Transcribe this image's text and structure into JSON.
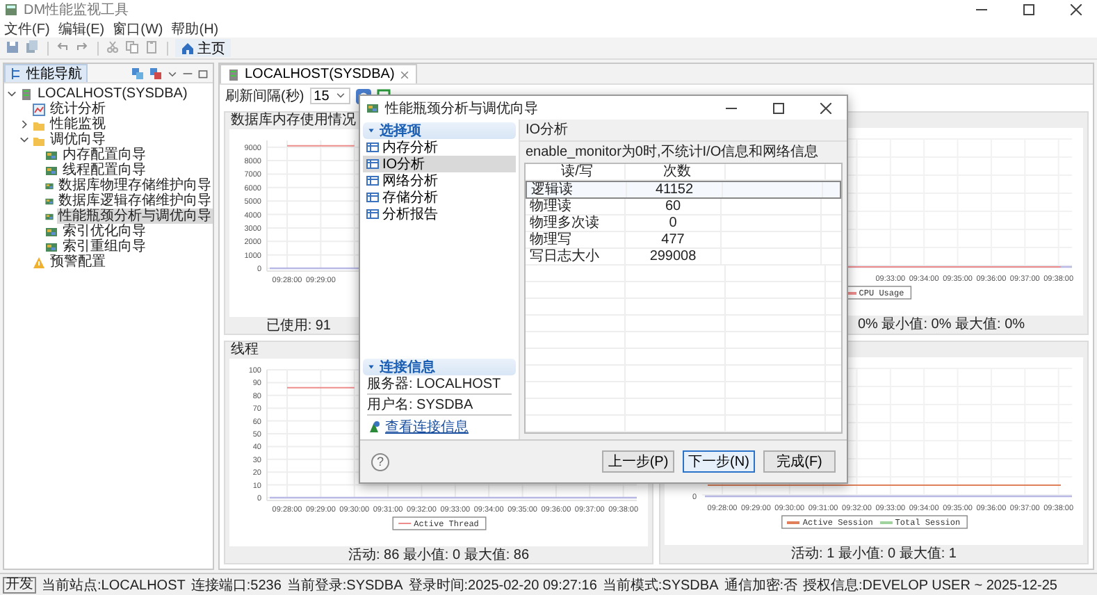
{
  "window": {
    "title": "DM性能监视工具"
  },
  "menu": [
    "文件(F)",
    "编辑(E)",
    "窗口(W)",
    "帮助(H)"
  ],
  "toolbar": {
    "home_tab": "主页"
  },
  "navigator": {
    "title": "性能导航",
    "tree": [
      {
        "label": "LOCALHOST(SYSDBA)",
        "kind": "server",
        "expanded": true,
        "selected": false,
        "children": [
          {
            "label": "统计分析",
            "kind": "stats",
            "selected": false
          },
          {
            "label": "性能监视",
            "kind": "folder",
            "expanded": false,
            "selected": false
          },
          {
            "label": "调优向导",
            "kind": "folder",
            "expanded": true,
            "selected": false,
            "children": [
              {
                "label": "内存配置向导",
                "kind": "wizard",
                "selected": false
              },
              {
                "label": "线程配置向导",
                "kind": "wizard",
                "selected": false
              },
              {
                "label": "数据库物理存储维护向导",
                "kind": "wizard",
                "selected": false
              },
              {
                "label": "数据库逻辑存储维护向导",
                "kind": "wizard",
                "selected": false
              },
              {
                "label": "性能瓶颈分析与调优向导",
                "kind": "wizard",
                "selected": true
              },
              {
                "label": "索引优化向导",
                "kind": "wizard",
                "selected": false
              },
              {
                "label": "索引重组向导",
                "kind": "wizard",
                "selected": false
              }
            ]
          },
          {
            "label": "预警配置",
            "kind": "alert",
            "selected": false
          }
        ]
      }
    ]
  },
  "editor": {
    "tab": "LOCALHOST(SYSDBA)",
    "refresh_label": "刷新间隔(秒)",
    "refresh_value": "15"
  },
  "charts": [
    {
      "title": "数据库内存使用情况",
      "footer": "已使用: 91",
      "chart_data": {
        "type": "line",
        "grid": true,
        "categories": [
          "09:28:00",
          "09:29:00",
          null,
          null,
          null,
          null,
          null,
          null,
          null,
          null,
          null
        ],
        "ylim": [
          0,
          9500
        ],
        "yticks": [
          0,
          1000,
          2000,
          3000,
          4000,
          5000,
          6000,
          7000,
          8000,
          9000
        ],
        "series": [
          {
            "color": "#ee8c8c",
            "values": [
              9100,
              9100,
              9100,
              null,
              null,
              null,
              null,
              null,
              null,
              null,
              null
            ]
          }
        ]
      }
    },
    {
      "footer": "0%  最小值: 0%  最大值: 0%",
      "x_labels": [
        "09:33:00",
        "09:34:00",
        "09:35:00",
        "09:36:00",
        "09:37:00",
        "09:38:00"
      ],
      "legend": [
        {
          "name": "CPU Usage",
          "color": "#ee8c8c"
        }
      ]
    },
    {
      "title": "线程",
      "footer": "活动: 86  最小值: 0  最大值: 86",
      "chart_data": {
        "type": "line",
        "grid": true,
        "categories": [
          "09:28:00",
          "09:29:00",
          "09:30:00",
          "09:31:00",
          "09:32:00",
          "09:33:00",
          "09:34:00",
          "09:35:00",
          "09:36:00",
          "09:37:00",
          "09:38:00"
        ],
        "ylim": [
          0,
          100
        ],
        "yticks": [
          0,
          10,
          20,
          30,
          40,
          50,
          60,
          70,
          80,
          90,
          100
        ],
        "series": [
          {
            "name": "Active Thread",
            "color": "#ee8c8c",
            "values": [
              86,
              86,
              86,
              null,
              null,
              null,
              null,
              null,
              null,
              null,
              null
            ]
          }
        ]
      }
    },
    {
      "footer": "活动: 1  最小值: 0  最大值: 1",
      "x_labels": [
        "09:28:00",
        "09:29:00",
        "09:30:00",
        "09:31:00",
        "09:32:00",
        "09:33:00",
        "09:34:00",
        "09:35:00",
        "09:36:00",
        "09:37:00",
        "09:38:00"
      ],
      "y_labels": [
        "0"
      ],
      "legend": [
        {
          "name": "Active Session",
          "color": "#e0805a"
        },
        {
          "name": "Total Session",
          "color": "#9fd49f"
        }
      ]
    }
  ],
  "dialog": {
    "title": "性能瓶颈分析与调优向导",
    "nav_title": "选择项",
    "nav_items": [
      {
        "label": "内存分析",
        "selected": false
      },
      {
        "label": "IO分析",
        "selected": true
      },
      {
        "label": "网络分析",
        "selected": false
      },
      {
        "label": "存储分析",
        "selected": false
      },
      {
        "label": "分析报告",
        "selected": false
      }
    ],
    "conn_title": "连接信息",
    "conn_info": [
      "服务器: LOCALHOST",
      "用户名: SYSDBA"
    ],
    "conn_link": "查看连接信息",
    "page_title": "IO分析",
    "description": "enable_monitor为0时,不统计I/O信息和网络信息",
    "table": {
      "columns": [
        "读/写",
        "次数"
      ],
      "rows": [
        {
          "cells": [
            "逻辑读",
            "41152"
          ],
          "selected": true
        },
        {
          "cells": [
            "物理读",
            "60"
          ],
          "selected": false
        },
        {
          "cells": [
            "物理多次读",
            "0"
          ],
          "selected": false
        },
        {
          "cells": [
            "物理写",
            "477"
          ],
          "selected": false
        },
        {
          "cells": [
            "写日志大小",
            "299008"
          ],
          "selected": false
        }
      ]
    },
    "help": "?",
    "buttons": [
      {
        "label": "上一步(P)",
        "default": false
      },
      {
        "label": "下一步(N)",
        "default": true
      },
      {
        "label": "完成(F)",
        "default": false
      }
    ]
  },
  "status_bar": {
    "badge": "开发",
    "items": [
      "当前站点:LOCALHOST",
      "连接端口:5236",
      "当前登录:SYSDBA",
      "登录时间:2025-02-20 09:27:16",
      "当前模式:SYSDBA",
      "通信加密:否",
      "授权信息:DEVELOP USER ~ 2025-12-25"
    ]
  }
}
